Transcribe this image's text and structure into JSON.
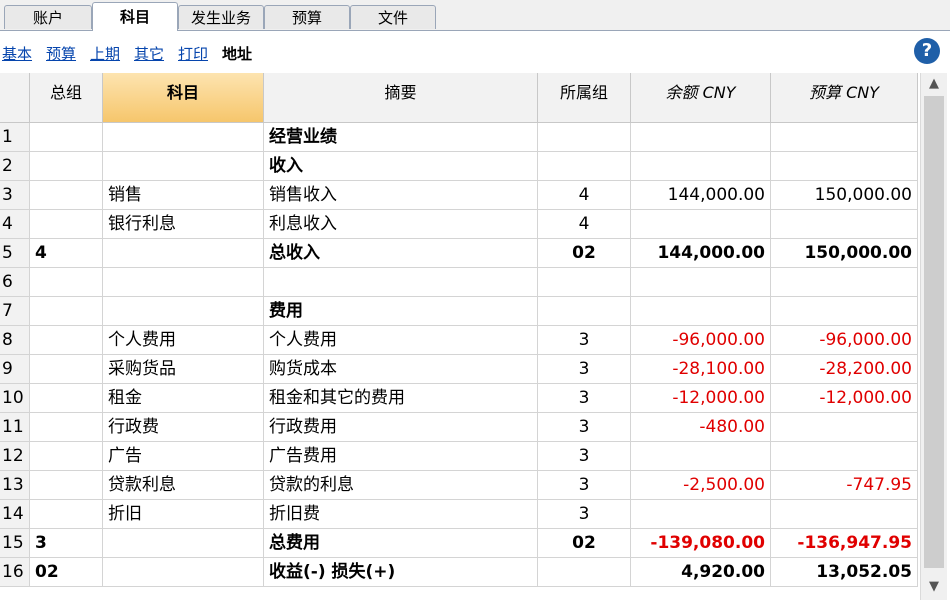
{
  "tabs": [
    "账户",
    "科目",
    "发生业务",
    "预算",
    "文件"
  ],
  "subnav": [
    "基本",
    "预算",
    "上期",
    "其它",
    "打印",
    "地址"
  ],
  "help_label": "?",
  "columns": {
    "group": "总组",
    "account": "科目",
    "description": "摘要",
    "belongs": "所属组",
    "balance": "余额 CNY",
    "budget": "预算 CNY"
  },
  "rows": [
    {
      "n": "1",
      "group": "",
      "account": "",
      "desc": "经营业绩",
      "belongs": "",
      "balance": "",
      "budget": ""
    },
    {
      "n": "2",
      "group": "",
      "account": "",
      "desc": "收入",
      "belongs": "",
      "balance": "",
      "budget": ""
    },
    {
      "n": "3",
      "group": "",
      "account": "销售",
      "desc": "销售收入",
      "belongs": "4",
      "balance": "144,000.00",
      "budget": "150,000.00"
    },
    {
      "n": "4",
      "group": "",
      "account": "银行利息",
      "desc": "利息收入",
      "belongs": "4",
      "balance": "",
      "budget": ""
    },
    {
      "n": "5",
      "group": "4",
      "account": "",
      "desc": "总收入",
      "belongs": "02",
      "balance": "144,000.00",
      "budget": "150,000.00"
    },
    {
      "n": "6",
      "group": "",
      "account": "",
      "desc": "",
      "belongs": "",
      "balance": "",
      "budget": ""
    },
    {
      "n": "7",
      "group": "",
      "account": "",
      "desc": "费用",
      "belongs": "",
      "balance": "",
      "budget": ""
    },
    {
      "n": "8",
      "group": "",
      "account": "个人费用",
      "desc": "个人费用",
      "belongs": "3",
      "balance": "-96,000.00",
      "budget": "-96,000.00"
    },
    {
      "n": "9",
      "group": "",
      "account": "采购货品",
      "desc": "购货成本",
      "belongs": "3",
      "balance": "-28,100.00",
      "budget": "-28,200.00"
    },
    {
      "n": "10",
      "group": "",
      "account": "租金",
      "desc": "租金和其它的费用",
      "belongs": "3",
      "balance": "-12,000.00",
      "budget": "-12,000.00"
    },
    {
      "n": "11",
      "group": "",
      "account": "行政费",
      "desc": "行政费用",
      "belongs": "3",
      "balance": "-480.00",
      "budget": ""
    },
    {
      "n": "12",
      "group": "",
      "account": "广告",
      "desc": "广告费用",
      "belongs": "3",
      "balance": "",
      "budget": ""
    },
    {
      "n": "13",
      "group": "",
      "account": "贷款利息",
      "desc": "贷款的利息",
      "belongs": "3",
      "balance": "-2,500.00",
      "budget": "-747.95"
    },
    {
      "n": "14",
      "group": "",
      "account": "折旧",
      "desc": "折旧费",
      "belongs": "3",
      "balance": "",
      "budget": ""
    },
    {
      "n": "15",
      "group": "3",
      "account": "",
      "desc": "总费用",
      "belongs": "02",
      "balance": "-139,080.00",
      "budget": "-136,947.95"
    },
    {
      "n": "16",
      "group": "02",
      "account": "",
      "desc": "收益(-) 损失(+)",
      "belongs": "",
      "balance": "4,920.00",
      "budget": "13,052.05"
    }
  ],
  "colors": {
    "accent": "#f6c66c",
    "negative": "#e00000",
    "link": "#0645ad",
    "help": "#1f5fa8"
  },
  "icons": {
    "help": "help-icon",
    "scroll_up": "chevron-up-icon",
    "scroll_down": "chevron-down-icon"
  }
}
